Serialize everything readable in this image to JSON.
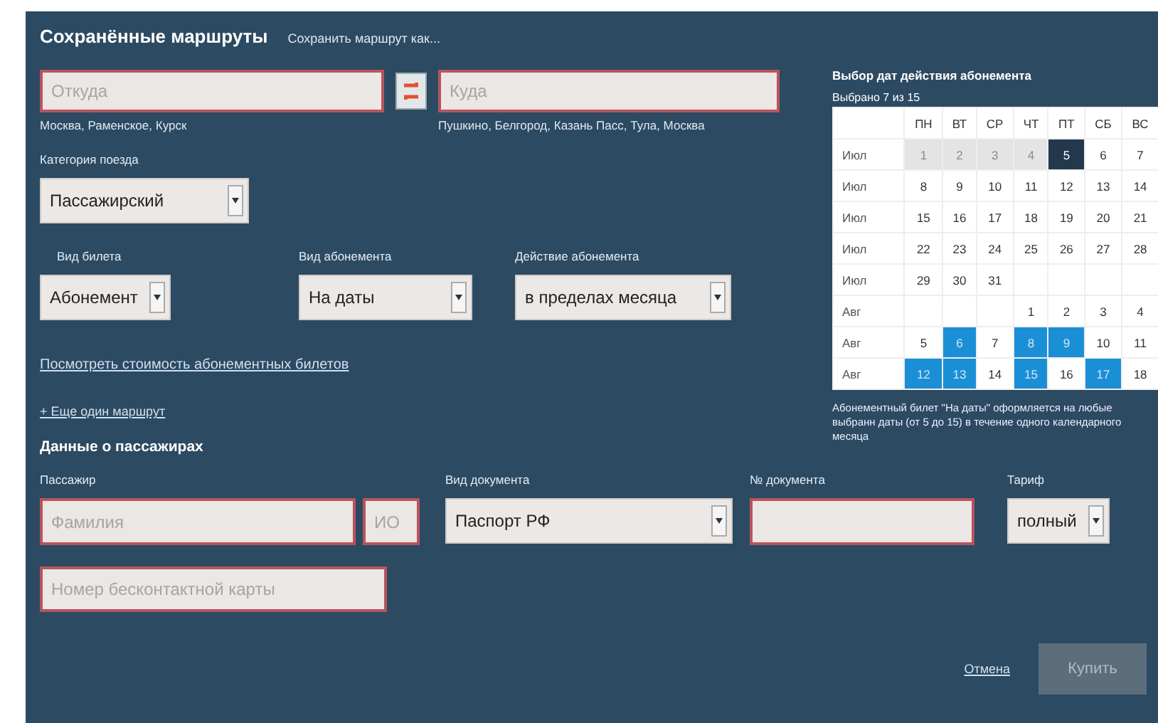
{
  "header": {
    "title": "Сохранённые маршруты",
    "save_link": "Сохранить маршрут как..."
  },
  "route": {
    "from": {
      "placeholder": "Откуда",
      "hint": "Москва, Раменское, Курск"
    },
    "to": {
      "placeholder": "Куда",
      "hint": "Пушкино, Белгород, Казань Пасс, Тула, Москва"
    }
  },
  "train_category": {
    "label": "Категория поезда",
    "value": "Пассажирский"
  },
  "ticket_type": {
    "label": "Вид билета",
    "value": "Абонемент"
  },
  "subscription_type": {
    "label": "Вид абонемента",
    "value": "На даты"
  },
  "subscription_action": {
    "label": "Действие абонемента",
    "value": "в пределах месяца"
  },
  "price_link": "Посмотреть стоимость абонементных билетов",
  "add_route_link": "+ Еще один маршрут",
  "passengers": {
    "title": "Данные о пассажирах",
    "passenger_label": "Пассажир",
    "surname": {
      "placeholder": "Фамилия"
    },
    "initials": {
      "placeholder": "ИО"
    },
    "doc_type": {
      "label": "Вид документа",
      "value": "Паспорт РФ"
    },
    "doc_number": {
      "label": "№ документа"
    },
    "tariff": {
      "label": "Тариф",
      "value": "полный"
    },
    "card": {
      "placeholder": "Номер бесконтактной карты"
    }
  },
  "calendar": {
    "title": "Выбор дат действия абонемента",
    "counter": "Выбрано 7 из 15",
    "weekdays": [
      "ПН",
      "ВТ",
      "СР",
      "ЧТ",
      "ПТ",
      "СБ",
      "ВС"
    ],
    "weeks": [
      {
        "month": "Июл",
        "days": [
          {
            "day": "1",
            "kind": "past"
          },
          {
            "day": "2",
            "kind": "past"
          },
          {
            "day": "3",
            "kind": "past"
          },
          {
            "day": "4",
            "kind": "past"
          },
          {
            "day": "5",
            "kind": "today"
          },
          {
            "day": "6",
            "kind": "normal"
          },
          {
            "day": "7",
            "kind": "normal"
          }
        ]
      },
      {
        "month": "Июл",
        "days": [
          {
            "day": "8",
            "kind": "normal"
          },
          {
            "day": "9",
            "kind": "normal"
          },
          {
            "day": "10",
            "kind": "normal"
          },
          {
            "day": "11",
            "kind": "normal"
          },
          {
            "day": "12",
            "kind": "normal"
          },
          {
            "day": "13",
            "kind": "normal"
          },
          {
            "day": "14",
            "kind": "normal"
          }
        ]
      },
      {
        "month": "Июл",
        "days": [
          {
            "day": "15",
            "kind": "normal"
          },
          {
            "day": "16",
            "kind": "normal"
          },
          {
            "day": "17",
            "kind": "normal"
          },
          {
            "day": "18",
            "kind": "normal"
          },
          {
            "day": "19",
            "kind": "normal"
          },
          {
            "day": "20",
            "kind": "normal"
          },
          {
            "day": "21",
            "kind": "normal"
          }
        ]
      },
      {
        "month": "Июл",
        "days": [
          {
            "day": "22",
            "kind": "normal"
          },
          {
            "day": "23",
            "kind": "normal"
          },
          {
            "day": "24",
            "kind": "normal"
          },
          {
            "day": "25",
            "kind": "normal"
          },
          {
            "day": "26",
            "kind": "normal"
          },
          {
            "day": "27",
            "kind": "normal"
          },
          {
            "day": "28",
            "kind": "normal"
          }
        ]
      },
      {
        "month": "Июл",
        "days": [
          {
            "day": "29",
            "kind": "normal"
          },
          {
            "day": "30",
            "kind": "normal"
          },
          {
            "day": "31",
            "kind": "normal"
          },
          {
            "kind": "empty"
          },
          {
            "kind": "empty"
          },
          {
            "kind": "empty"
          },
          {
            "kind": "empty"
          }
        ]
      },
      {
        "month": "Авг",
        "days": [
          {
            "kind": "empty"
          },
          {
            "kind": "empty"
          },
          {
            "kind": "empty"
          },
          {
            "day": "1",
            "kind": "normal"
          },
          {
            "day": "2",
            "kind": "normal"
          },
          {
            "day": "3",
            "kind": "normal"
          },
          {
            "day": "4",
            "kind": "normal"
          }
        ]
      },
      {
        "month": "Авг",
        "days": [
          {
            "day": "5",
            "kind": "normal"
          },
          {
            "day": "6",
            "kind": "selected"
          },
          {
            "day": "7",
            "kind": "normal"
          },
          {
            "day": "8",
            "kind": "selected"
          },
          {
            "day": "9",
            "kind": "selected"
          },
          {
            "day": "10",
            "kind": "normal"
          },
          {
            "day": "11",
            "kind": "normal"
          }
        ]
      },
      {
        "month": "Авг",
        "days": [
          {
            "day": "12",
            "kind": "selected"
          },
          {
            "day": "13",
            "kind": "selected"
          },
          {
            "day": "14",
            "kind": "normal"
          },
          {
            "day": "15",
            "kind": "selected"
          },
          {
            "day": "16",
            "kind": "normal"
          },
          {
            "day": "17",
            "kind": "selected"
          },
          {
            "day": "18",
            "kind": "normal"
          }
        ]
      }
    ],
    "note": "Абонементный билет \"На даты\" оформляется на любые выбранн даты (от 5 до 15) в течение одного календарного месяца"
  },
  "actions": {
    "cancel": "Отмена",
    "buy": {
      "label": "Купить",
      "disabled": true
    }
  }
}
